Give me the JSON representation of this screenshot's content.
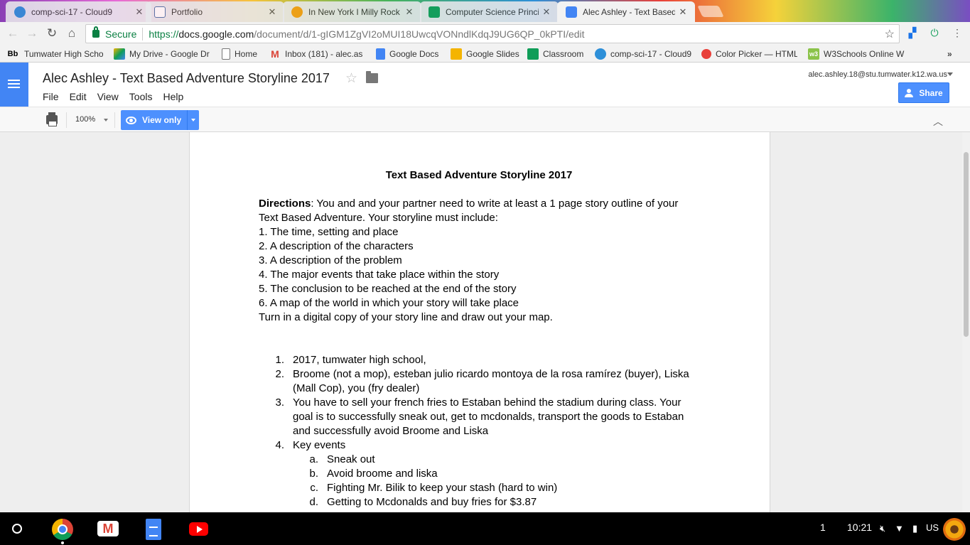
{
  "tabs": [
    {
      "title": "comp-sci-17 - Cloud9",
      "favicon_color": "#2d8fd8"
    },
    {
      "title": "Portfolio",
      "favicon_color": "#4a6fa5"
    },
    {
      "title": "In New York I Milly Rock",
      "favicon_color": "#f39c12"
    },
    {
      "title": "Computer Science Princi",
      "favicon_color": "#0f9d58"
    },
    {
      "title": "Alec Ashley - Text Based",
      "favicon_color": "#4285f4"
    }
  ],
  "omnibox": {
    "secure_label": "Secure",
    "scheme": "https://",
    "host": "docs.google.com",
    "path": "/document/d/1-gIGM1ZgVI2oMUI18UwcqVONndlKdqJ9UG6QP_0kPTI/edit"
  },
  "bookmarks": [
    {
      "label": "Tumwater High Scho",
      "icon": "Bb"
    },
    {
      "label": "My Drive - Google Dri",
      "icon": "drive-icon"
    },
    {
      "label": "Home",
      "icon": "page-icon"
    },
    {
      "label": "Inbox (181) - alec.as",
      "icon": "gmail-icon"
    },
    {
      "label": "Google Docs",
      "icon": "docs-icon"
    },
    {
      "label": "Google Slides",
      "icon": "slides-icon"
    },
    {
      "label": "Classroom",
      "icon": "classroom-icon"
    },
    {
      "label": "comp-sci-17 - Cloud9",
      "icon": "cloud9-icon"
    },
    {
      "label": "Color Picker — HTML",
      "icon": "color-icon"
    },
    {
      "label": "W3Schools Online W",
      "icon": "w3-icon"
    }
  ],
  "bookmarks_overflow": "»",
  "docs": {
    "title": "Alec Ashley - Text Based Adventure Storyline 2017",
    "menu": [
      "File",
      "Edit",
      "View",
      "Tools",
      "Help"
    ],
    "account_email": "alec.ashley.18@stu.tumwater.k12.wa.us",
    "share_label": "Share",
    "zoom": "100%",
    "mode_label": "View only"
  },
  "document": {
    "heading": "Text Based Adventure Storyline 2017",
    "directions_label": "Directions",
    "directions_text": ": You and and your partner need to write at least a 1 page story outline of your Text Based Adventure. Your storyline must include:",
    "requirements": [
      "1. The time, setting and place",
      "2. A description of the characters",
      "3. A description of the problem",
      "4. The major events that take place within the story",
      "5. The conclusion to be reached at the end of the story",
      "6. A map of the world in which your story will take place"
    ],
    "turn_in": "Turn in a digital copy of your story line and draw out your map.",
    "answers": [
      {
        "n": "1.",
        "text": "2017, tumwater high school,"
      },
      {
        "n": "2.",
        "text": "Broome (not a mop), esteban julio ricardo montoya de la rosa ramírez (buyer), Liska (Mall Cop), you (fry dealer)"
      },
      {
        "n": "3.",
        "text": "You have to sell your french fries to Estaban behind the stadium during class. Your goal is to successfully sneak out, get to mcdonalds, transport the goods to Estaban and successfully avoid Broome and Liska"
      },
      {
        "n": "4.",
        "text": "Key events"
      }
    ],
    "key_events": [
      {
        "n": "a.",
        "text": "Sneak out"
      },
      {
        "n": "b.",
        "text": "Avoid broome and liska"
      },
      {
        "n": "c.",
        "text": "Fighting Mr. Bilik to keep your stash (hard to win)"
      },
      {
        "n": "d.",
        "text": "Getting to Mcdonalds and buy fries for $3.87"
      }
    ]
  },
  "shelf": {
    "notification_count": "1",
    "time": "10:21",
    "input_method": "US"
  }
}
